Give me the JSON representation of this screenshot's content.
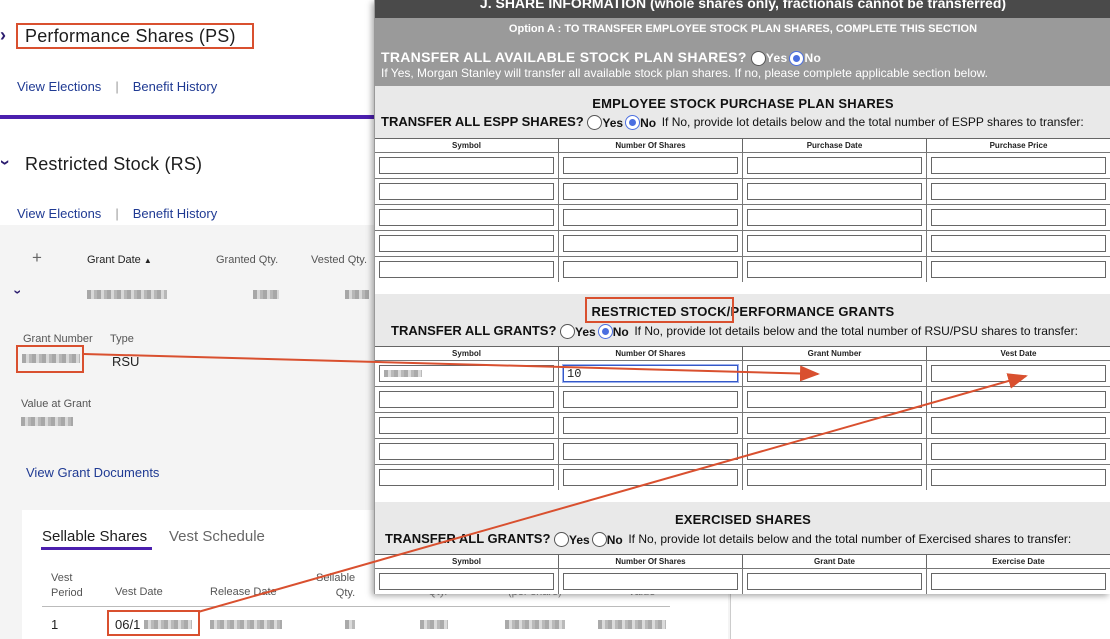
{
  "left": {
    "ps_title": "Performance Shares (PS)",
    "rs_title": "Restricted Stock (RS)",
    "view_elections": "View Elections",
    "separator": "|",
    "benefit_history": "Benefit History",
    "plus": "+",
    "grant_date_header": "Grant Date",
    "sort_icon": "▲",
    "granted_qty_header": "Granted Qty.",
    "vested_qty_header": "Vested Qty.",
    "grant_number_label": "Grant Number",
    "type_label": "Type",
    "type_value": "RSU",
    "value_at_grant_label": "Value at Grant",
    "view_grant_documents": "View Grant Documents",
    "tabs": [
      "Sellable Shares",
      "Vest Schedule"
    ],
    "table_headers": [
      "Vest\nPeriod",
      "Vest Date",
      "Release Date",
      "Sellable\nQty.",
      "Qty.",
      "(per share)",
      "Value"
    ],
    "row": {
      "vest_period": "1",
      "vest_date_prefix": "06/1"
    }
  },
  "form": {
    "section_header": "J. SHARE INFORMATION (whole shares only, fractionals cannot be transferred)",
    "option_a": "Option A : TO TRANSFER EMPLOYEE STOCK PLAN SHARES, COMPLETE THIS SECTION",
    "transfer_all_q": "TRANSFER ALL AVAILABLE STOCK PLAN SHARES?",
    "yes": "Yes",
    "no": "No",
    "transfer_all_note": "If Yes, Morgan Stanley will transfer all available stock plan shares. If no, please complete applicable section below.",
    "espp": {
      "title": "EMPLOYEE STOCK PURCHASE PLAN SHARES",
      "question": "TRANSFER ALL ESPP SHARES?",
      "note": "If No, provide lot details below and the total number of ESPP shares to transfer:",
      "columns": [
        "Symbol",
        "Number Of Shares",
        "Purchase Date",
        "Purchase Price"
      ]
    },
    "rs": {
      "title": "RESTRICTED STOCK/PERFORMANCE GRANTS",
      "question": "TRANSFER ALL GRANTS?",
      "note": "If No, provide lot details below and the total number of RSU/PSU shares to transfer:",
      "columns": [
        "Symbol",
        "Number Of Shares",
        "Grant Number",
        "Vest Date"
      ],
      "shares_value": "10"
    },
    "ex": {
      "title": "EXERCISED SHARES",
      "question": "TRANSFER ALL GRANTS?",
      "note": "If No, provide lot details below and the total number of Exercised shares to transfer:",
      "columns": [
        "Symbol",
        "Number Of Shares",
        "Grant Date",
        "Exercise Date"
      ]
    }
  },
  "colors": {
    "accent": "#4b1fae",
    "annotation": "#d9502f",
    "link": "#1f3a93"
  }
}
